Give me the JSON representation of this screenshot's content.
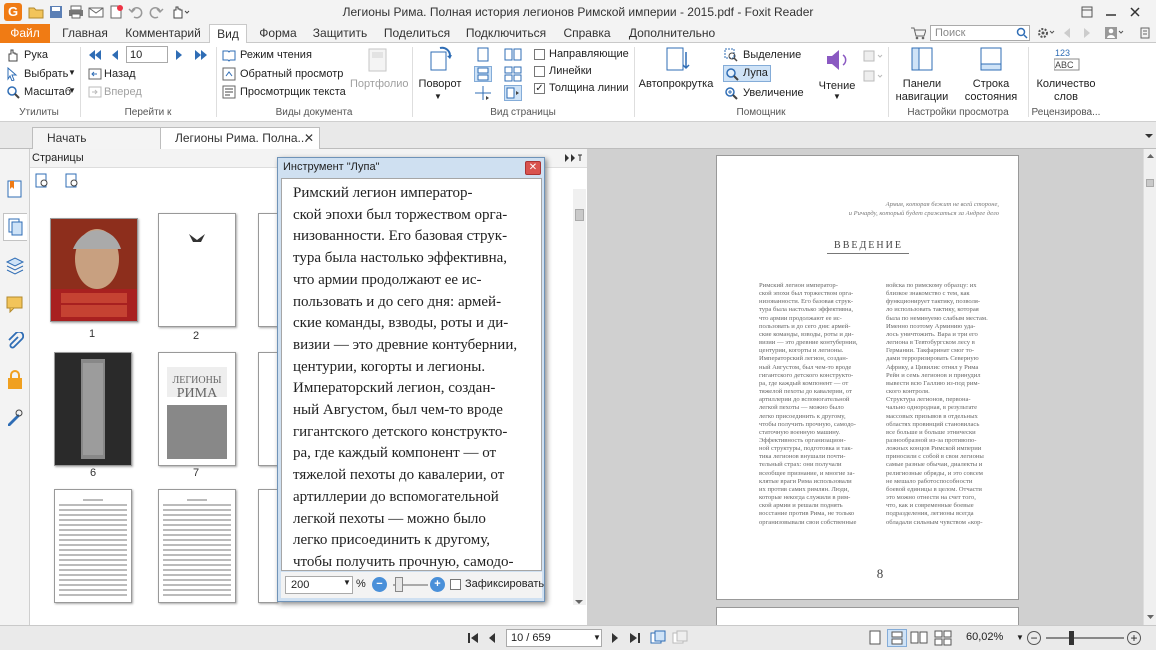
{
  "window": {
    "title": "Легионы Рима. Полная история легионов Римской империи - 2015.pdf - Foxit Reader",
    "search_placeholder": "Поиск"
  },
  "menu_tabs": [
    "Файл",
    "Главная",
    "Комментарий",
    "Вид",
    "Форма",
    "Защитить",
    "Поделиться",
    "Подключиться",
    "Справка",
    "Дополнительно"
  ],
  "ribbon": {
    "utilities": {
      "hand": "Рука",
      "select": "Выбрать",
      "zoom": "Масштаб",
      "group": "Утилиты"
    },
    "goto": {
      "page_value": "10",
      "back": "Назад",
      "forward": "Вперед",
      "group": "Перейти к"
    },
    "doc_views": {
      "reading_mode": "Режим чтения",
      "reverse_view": "Обратный просмотр",
      "text_viewer": "Просмотрщик текста",
      "portfolio": "Портфолио",
      "group": "Виды документа"
    },
    "page_view": {
      "rotate": "Поворот",
      "guides": "Направляющие",
      "rulers": "Линейки",
      "line_weights": "Толщина линии",
      "group": "Вид страницы"
    },
    "assistant": {
      "autoscroll": "Автопрокрутка",
      "marquee": "Выделение",
      "loupe": "Лупа",
      "magnifier": "Увеличение",
      "reading": "Чтение",
      "group": "Помощник"
    },
    "view_settings": {
      "nav_panels": "Панели навигации",
      "status_bar": "Строка состояния",
      "group": "Настройки просмотра"
    },
    "review": {
      "word_count": "Количество слов",
      "group": "Рецензирова..."
    }
  },
  "doc_tabs": {
    "start": "Начать",
    "doc": "Легионы Рима. Полна..."
  },
  "panel": {
    "title": "Страницы",
    "thumb_numbers": [
      "1",
      "2",
      "6",
      "7"
    ]
  },
  "magnifier": {
    "title": "Инструмент \"Лупа\"",
    "zoom_value": "200",
    "percent": "%",
    "lock_label": "Зафиксировать",
    "text": "     Римский легион император-\nской эпохи был торжеством орга-\nнизованности. Его базовая струк-\nтура была настолько эффективна,\nчто армии продолжают ее ис-\nпользовать и до сего дня: армей-\nские команды, взводы, роты и ди-\nвизии — это древние контубернии,\nцентурии, когорты и легионы.\nИмператорский легион, создан-\nный Августом, был чем-то вроде\nгигантского детского конструкто-\nра, где каждый компонент — от\nтяжелой пехоты до кавалерии, от\nартиллерии до вспомогательной\nлегкой пехоты — можно было\nлегко присоединить к другому,\nчтобы получить прочную, самодо-\nстаточную военную машину.\n     Эффективность организацион-\nной структуры, подготовка и так-"
  },
  "page": {
    "epigraph_1": "Армия, которая бежит не всей стороне,",
    "epigraph_2": "и Ричарду, который будет сражаться за Андрее дело",
    "heading": "ВВЕДЕНИЕ",
    "left_col": "Римский легион император-\nской эпохи был торжеством орга-\nнизованности. Его базовая струк-\nтура была настолько эффективна,\nчто армии продолжают ее ис-\nпользовать и до сего дня: армей-\nские команды, взводы, роты и ди-\nвизии — это древние контубернии,\nцентурии, когорты и легионы.\nИмператорский легион, создан-\nный Августом, был чем-то вроде\nгигантского детского конструкто-\nра, где каждый компонент — от\nтяжелой пехоты до кавалерии, от\nартиллерии до вспомогательной\nлегкой пехоты — можно было\nлегко присоединить к другому,\nчтобы получить прочную, самодо-\nстаточную военную машину.\n   Эффективность организацион-\nной структуры, подготовка и так-\nтика легионов внушали почти-\nтельный страх: они получали\nвсеобщее признание, и многие за-\nклятые враги Рима использовали\nих против самих римлян. Люди,\nкоторые некогда служили в рим-\nской армии и решали поднять\nвосстание против Рима, не только\nорганизовывали свои собственные",
    "right_col": "войска по римскому образцу: их\nблизкое знакомство с тем, как\nфункционирует тактику, позволя-\nло использовать тактику, которая\nбыла по неминуемо слабым местам.\nИменно поэтому Арминию уда-\nлось уничтожить. Вара и три его\nлегиона в Тевтобургском лесу в\nГермании. Такфаринат смог то-\nдами терроризировать Северную\nАфрику, а Цивилис отнял у Рима\nРейн и семь легионов и принудил\nвывести всю Галлию из-под рим-\nского контроля.\n   Структура легионов, первона-\nчально однородная, в результате\nмассовых призывов в отдельных\nобластях провинций становилась\nвсе больше и больше этнически\nразнообразной из-за противопо-\nложных концов Римской империи\nприносили с собой в свои легионы\nсамые разные обычаи, диалекты и\nрелигиозные обряды, и это совсем\nне мешало работоспособности\nбоевой единицы в целом. Отчасти\nэто можно отнести на счет того,\nчто, как и современные боевые\nподразделения, легионы всегда\nобладали сильным чувством «кор-",
    "page_number": "8"
  },
  "status": {
    "page_indicator": "10 / 659",
    "zoom_percent": "60,02%"
  },
  "colors": {
    "accent": "#f07b14",
    "ribbon_blue": "#2f6db5",
    "highlight": "#cfe3f7"
  }
}
